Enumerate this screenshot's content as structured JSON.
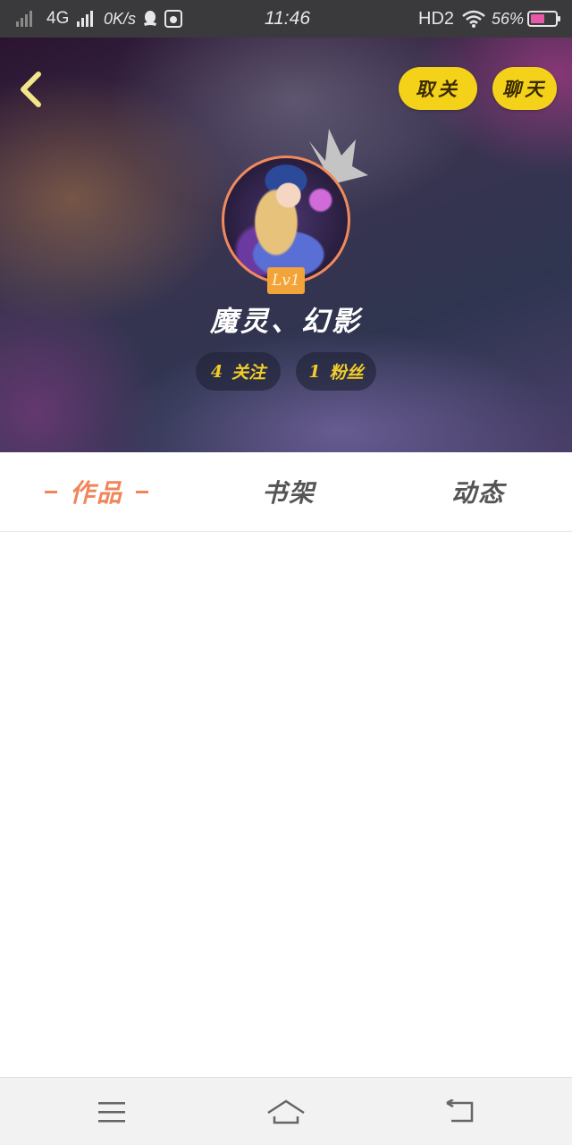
{
  "status_bar": {
    "network": "4G",
    "speed": "0K/s",
    "time": "11:46",
    "hd": "HD2",
    "battery": "56%"
  },
  "header": {
    "unfollow_label": "取关",
    "chat_label": "聊天"
  },
  "profile": {
    "level": "Lv1",
    "username": "魔灵、幻影",
    "following_count": "4",
    "following_label": "关注",
    "followers_count": "1",
    "followers_label": "粉丝"
  },
  "tabs": [
    {
      "label": "作品",
      "active": true
    },
    {
      "label": "书架",
      "active": false
    },
    {
      "label": "动态",
      "active": false
    }
  ],
  "colors": {
    "accent_yellow": "#f5d21a",
    "accent_orange": "#f0855a",
    "level_badge": "#f2a33a",
    "status_bar_bg": "#3a3a3c"
  },
  "nav_icons": [
    "menu-icon",
    "home-icon",
    "back-icon"
  ]
}
